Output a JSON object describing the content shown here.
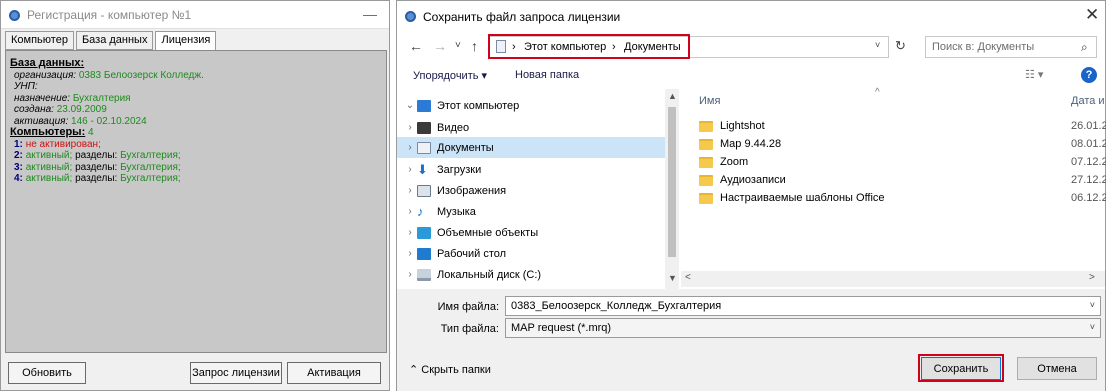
{
  "left_window": {
    "title": "Регистрация - компьютер №1",
    "minimize_glyph": "—",
    "tabs": [
      "Компьютер",
      "База данных",
      "Лицензия"
    ],
    "active_tab": "Лицензия",
    "db": {
      "header": "База данных:",
      "org_label": "организация:",
      "org_value": "0383 Белоозерск Колледж.",
      "unp_label": "УНП:",
      "purpose_label": "назначение:",
      "purpose_value": "Бухгалтерия",
      "created_label": "создана:",
      "created_value": "23.09.2009",
      "activation_label": "активация:",
      "activation_value": "146 - 02.10.2024"
    },
    "computers": {
      "header": "Компьютеры:",
      "count": "4",
      "rows": [
        {
          "num": "1:",
          "status": "не активирован;",
          "sections_label": "",
          "sections_value": ""
        },
        {
          "num": "2:",
          "status": "активный;",
          "sections_label": "разделы:",
          "sections_value": "Бухгалтерия;"
        },
        {
          "num": "3:",
          "status": "активный;",
          "sections_label": "разделы:",
          "sections_value": "Бухгалтерия;"
        },
        {
          "num": "4:",
          "status": "активный;",
          "sections_label": "разделы:",
          "sections_value": "Бухгалтерия;"
        }
      ]
    },
    "buttons": {
      "refresh": "Обновить",
      "license_request": "Запрос лицензии",
      "activation": "Активация"
    }
  },
  "dialog": {
    "title": "Сохранить файл запроса лицензии",
    "close_glyph": "✕",
    "nav": {
      "back": "←",
      "forward": "→",
      "dropdown": "˅",
      "up": "↑"
    },
    "breadcrumb": [
      "Этот компьютер",
      "Документы"
    ],
    "breadcrumb_sep": "›",
    "refresh_glyph": "↻",
    "search_placeholder": "Поиск в: Документы",
    "toolbar": {
      "organize": "Упорядочить ▾",
      "new_folder": "Новая папка"
    },
    "help_glyph": "?",
    "tree": [
      {
        "label": "Этот компьютер",
        "icon": "pc-icon",
        "color": "#2b7bd6",
        "expanded": true
      },
      {
        "label": "Видео",
        "icon": "video-icon",
        "color": "#3a3a3a"
      },
      {
        "label": "Документы",
        "icon": "documents-icon",
        "color": "#7a8aa0",
        "selected": true
      },
      {
        "label": "Загрузки",
        "icon": "downloads-icon",
        "color": "#1a6fd0"
      },
      {
        "label": "Изображения",
        "icon": "pictures-icon",
        "color": "#6a7a8a"
      },
      {
        "label": "Музыка",
        "icon": "music-icon",
        "color": "#1a6fd0"
      },
      {
        "label": "Объемные объекты",
        "icon": "3d-objects-icon",
        "color": "#2a9ad8"
      },
      {
        "label": "Рабочий стол",
        "icon": "desktop-icon",
        "color": "#1e7bd0"
      },
      {
        "label": "Локальный диск (C:)",
        "icon": "drive-icon",
        "color": "#8a9aaa"
      }
    ],
    "columns": {
      "name": "Имя",
      "date": "Дата и"
    },
    "files": [
      {
        "name": "Lightshot",
        "date": "26.01.2"
      },
      {
        "name": "Map 9.44.28",
        "date": "08.01.2"
      },
      {
        "name": "Zoom",
        "date": "07.12.2"
      },
      {
        "name": "Аудиозаписи",
        "date": "27.12.2"
      },
      {
        "name": "Настраиваемые шаблоны Office",
        "date": "06.12.2"
      }
    ],
    "filename_label": "Имя файла:",
    "filename_value": "0383_Белоозерск_Колледж_Бухгалтерия",
    "filetype_label": "Тип файла:",
    "filetype_value": "MAP request (*.mrq)",
    "hide_folders": "Скрыть папки",
    "save_button": "Сохранить",
    "cancel_button": "Отмена",
    "highlight_color": "#d0021b"
  }
}
